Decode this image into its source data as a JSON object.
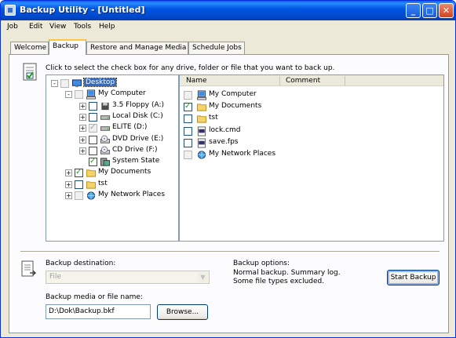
{
  "window": {
    "title": "Backup Utility - [Untitled]"
  },
  "title_buttons": {
    "minimize": "_",
    "maximize": "□",
    "close": "✕"
  },
  "menu": [
    "Job",
    "Edit",
    "View",
    "Tools",
    "Help"
  ],
  "tabs": [
    "Welcome",
    "Backup",
    "Restore and Manage Media",
    "Schedule Jobs"
  ],
  "active_tab": "Backup",
  "backup": {
    "instruction": "Click to select the check box for any drive, folder or file that you want to back up.",
    "tree": [
      {
        "label": "Desktop",
        "icon": "desktop-icon",
        "expander": "-",
        "check": "gray",
        "selected": true
      },
      {
        "label": "My Computer",
        "icon": "my-computer-icon",
        "expander": "-",
        "check": "gray"
      },
      {
        "label": "3.5 Floppy (A:)",
        "icon": "floppy-icon",
        "expander": "+",
        "check": "empty"
      },
      {
        "label": "Local Disk (C:)",
        "icon": "disk-icon",
        "expander": "+",
        "check": "empty"
      },
      {
        "label": "ELITE (D:)",
        "icon": "disk-icon",
        "expander": "+",
        "check": "grayck"
      },
      {
        "label": "DVD Drive (E:)",
        "icon": "cd-icon",
        "expander": "+",
        "check": "empty"
      },
      {
        "label": "CD Drive (F:)",
        "icon": "cd-icon",
        "expander": "+",
        "check": "empty"
      },
      {
        "label": "System State",
        "icon": "system-state-icon",
        "expander": "",
        "check": "checked"
      },
      {
        "label": "My Documents",
        "icon": "folder-icon",
        "expander": "+",
        "check": "checked"
      },
      {
        "label": "tst",
        "icon": "folder-icon",
        "expander": "+",
        "check": "empty"
      },
      {
        "label": "My Network Places",
        "icon": "network-icon",
        "expander": "+",
        "check": "gray"
      }
    ],
    "list_columns": [
      "Name",
      "Comment"
    ],
    "list": [
      {
        "label": "My Computer",
        "icon": "my-computer-icon",
        "check": "gray"
      },
      {
        "label": "My Documents",
        "icon": "folder-icon",
        "check": "checked"
      },
      {
        "label": "tst",
        "icon": "folder-icon",
        "check": "empty"
      },
      {
        "label": "lock.cmd",
        "icon": "file-icon",
        "check": "empty"
      },
      {
        "label": "save.fps",
        "icon": "file-icon",
        "check": "empty"
      },
      {
        "label": "My Network Places",
        "icon": "network-icon",
        "check": "gray"
      }
    ],
    "destination_label": "Backup destination:",
    "destination_value": "File",
    "media_label": "Backup media or file name:",
    "media_value": "D:\\Dok\\Backup.bkf",
    "browse_label": "Browse...",
    "options_label": "Backup options:",
    "options_line1": "Normal backup.  Summary log.",
    "options_line2": "Some file types excluded.",
    "start_label": "Start Backup"
  },
  "colors": {
    "titlebar": "#0054e3",
    "selection": "#316ac5",
    "tab_highlight": "#ffc83c",
    "check": "#21a121"
  }
}
